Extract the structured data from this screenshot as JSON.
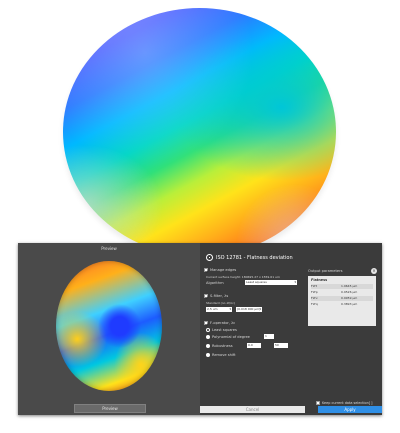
{
  "preview_panel": {
    "title": "Preview",
    "preview_button": "Preview"
  },
  "dialog": {
    "title": "ISO 12781 - Flatness deviation",
    "image_edges": {
      "label": "Manage edges",
      "checked": true
    },
    "method_label": "Current surface height: 180695.27 x 1559.61 um",
    "algorithm": {
      "label": "Algorithm",
      "value": "Least squares"
    },
    "s_filter": {
      "label": "S-filter, λs",
      "checked": true
    },
    "filter_note": "Standard (no λf/λc)",
    "lambda_unit": "2.5 um",
    "lambda_value": "(0.018 000 μm)",
    "f_operator": {
      "label": "F-operator, λc",
      "checked": true
    },
    "options": [
      {
        "label": "Least squares",
        "selected": true
      },
      {
        "label": "Polynomial of degree",
        "selected": false,
        "value": "1"
      },
      {
        "label": "Robustness",
        "selected": false,
        "value_a": "0.0",
        "value_b": "50"
      },
      {
        "label": "Remove shift",
        "selected": false
      }
    ]
  },
  "results": {
    "title": "Output parameters",
    "close_icon": "close-icon",
    "group_title": "Flatness",
    "rows": [
      {
        "name": "FLTt",
        "value": "1.9645 μm"
      },
      {
        "name": "FLTp",
        "value": "0.9526 μm"
      },
      {
        "name": "FLTv",
        "value": "0.9959 μm"
      },
      {
        "name": "FLTq",
        "value": "0.3893 μm"
      }
    ]
  },
  "footer": {
    "keep_data_label": "Keep current data selection[ ]",
    "cancel_label": "Cancel",
    "apply_label": "Apply"
  },
  "colors": {
    "dialog_bg": "#3b3b3b",
    "left_panel_bg": "#4a4a4a",
    "apply_blue": "#2f8fe6"
  }
}
